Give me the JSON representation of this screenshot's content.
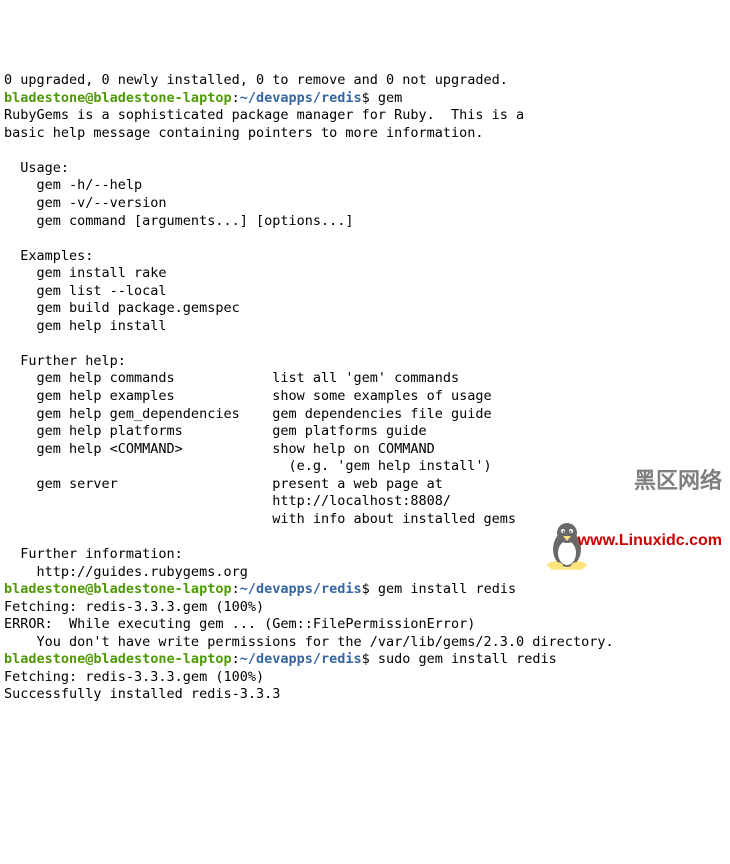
{
  "top_cut": "0 upgraded, 0 newly installed, 0 to remove and 0 not upgraded.",
  "prompt": {
    "user_host": "bladestone@bladestone-laptop",
    "sep": ":",
    "path": "~/devapps/redis",
    "dollar": "$"
  },
  "cmd1": " gem",
  "help": {
    "l1": "RubyGems is a sophisticated package manager for Ruby.  This is a",
    "l2": "basic help message containing pointers to more information.",
    "usage_h": "  Usage:",
    "usage_1": "    gem -h/--help",
    "usage_2": "    gem -v/--version",
    "usage_3": "    gem command [arguments...] [options...]",
    "ex_h": "  Examples:",
    "ex_1": "    gem install rake",
    "ex_2": "    gem list --local",
    "ex_3": "    gem build package.gemspec",
    "ex_4": "    gem help install",
    "fh_h": "  Further help:",
    "fh_1": "    gem help commands            list all 'gem' commands",
    "fh_2": "    gem help examples            show some examples of usage",
    "fh_3": "    gem help gem_dependencies    gem dependencies file guide",
    "fh_4": "    gem help platforms           gem platforms guide",
    "fh_5": "    gem help <COMMAND>           show help on COMMAND",
    "fh_6": "                                   (e.g. 'gem help install')",
    "fh_7": "    gem server                   present a web page at",
    "fh_8": "                                 http://localhost:8808/",
    "fh_9": "                                 with info about installed gems",
    "fi_h": "  Further information:",
    "fi_1": "    http://guides.rubygems.org"
  },
  "cmd2": " gem install redis",
  "out2": {
    "l1": "Fetching: redis-3.3.3.gem (100%)",
    "l2": "ERROR:  While executing gem ... (Gem::FilePermissionError)",
    "l3": "    You don't have write permissions for the /var/lib/gems/2.3.0 directory."
  },
  "cmd3": " sudo gem install redis",
  "out3": {
    "l1": "Fetching: redis-3.3.3.gem (100%)",
    "l2": "Successfully installed redis-3.3.3"
  },
  "watermark": {
    "wm1": "黑区网络",
    "wm2": "www.Linuxidc.com"
  }
}
